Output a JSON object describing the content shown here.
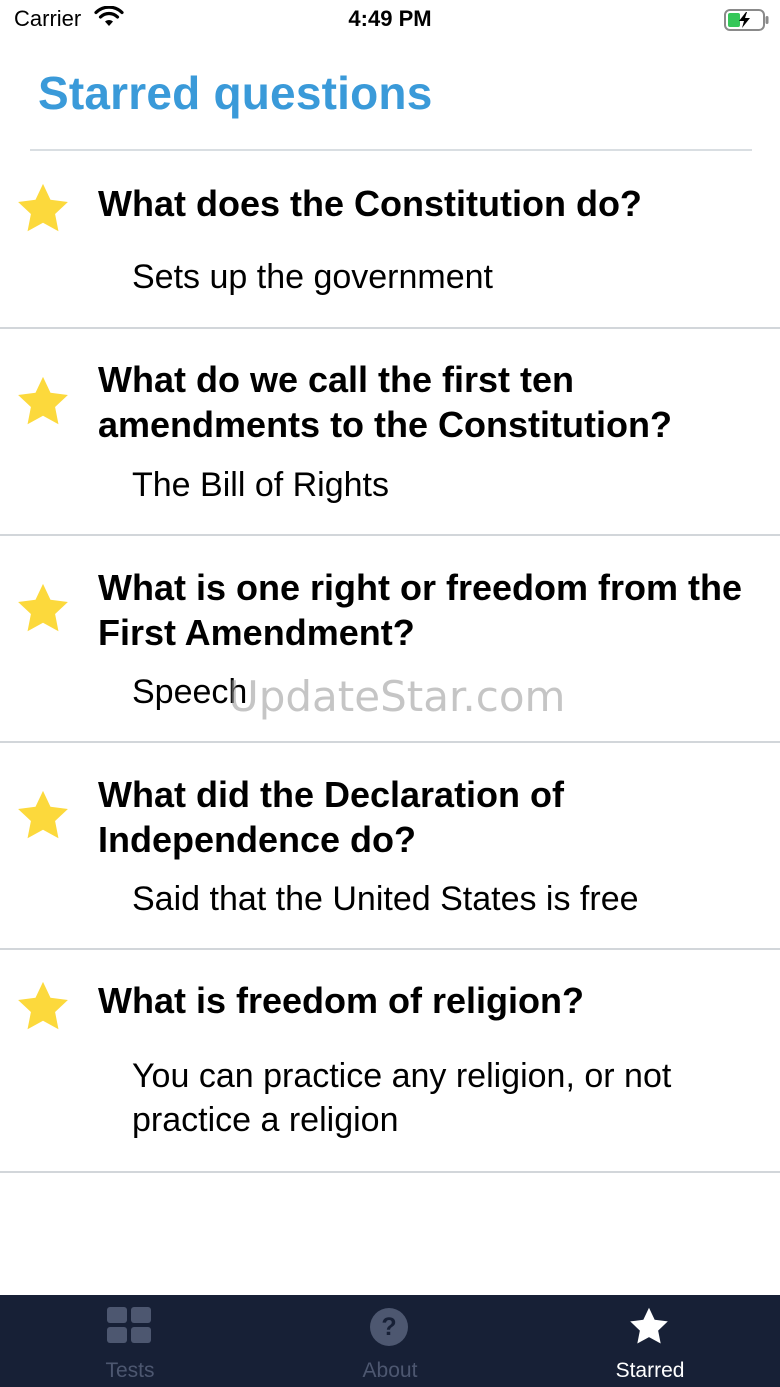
{
  "status_bar": {
    "carrier": "Carrier",
    "time": "4:49 PM"
  },
  "page": {
    "title": "Starred questions"
  },
  "questions": [
    {
      "question": "What does the Constitution do?",
      "answer": "Sets up the government"
    },
    {
      "question": "What do we call the first ten amendments to the Constitution?",
      "answer": "The Bill of Rights"
    },
    {
      "question": "What is one right or freedom from the First Amendment?",
      "answer": "Speech"
    },
    {
      "question": "What did the Declaration of Independence do?",
      "answer": "Said that the United States is free"
    },
    {
      "question": "What is freedom of religion?",
      "answer": "You can practice any religion, or not practice a religion"
    }
  ],
  "watermark": "UpdateStar.com",
  "tab_bar": {
    "tabs": [
      {
        "label": "Tests",
        "icon": "grid-icon",
        "active": false
      },
      {
        "label": "About",
        "icon": "question-circle-icon",
        "active": false
      },
      {
        "label": "Starred",
        "icon": "star-icon",
        "active": true
      }
    ]
  },
  "colors": {
    "title": "#3a9ad9",
    "star": "#fcd93c",
    "tab_bar_bg": "#172036",
    "tab_inactive": "#4d5770",
    "tab_active": "#ffffff"
  }
}
